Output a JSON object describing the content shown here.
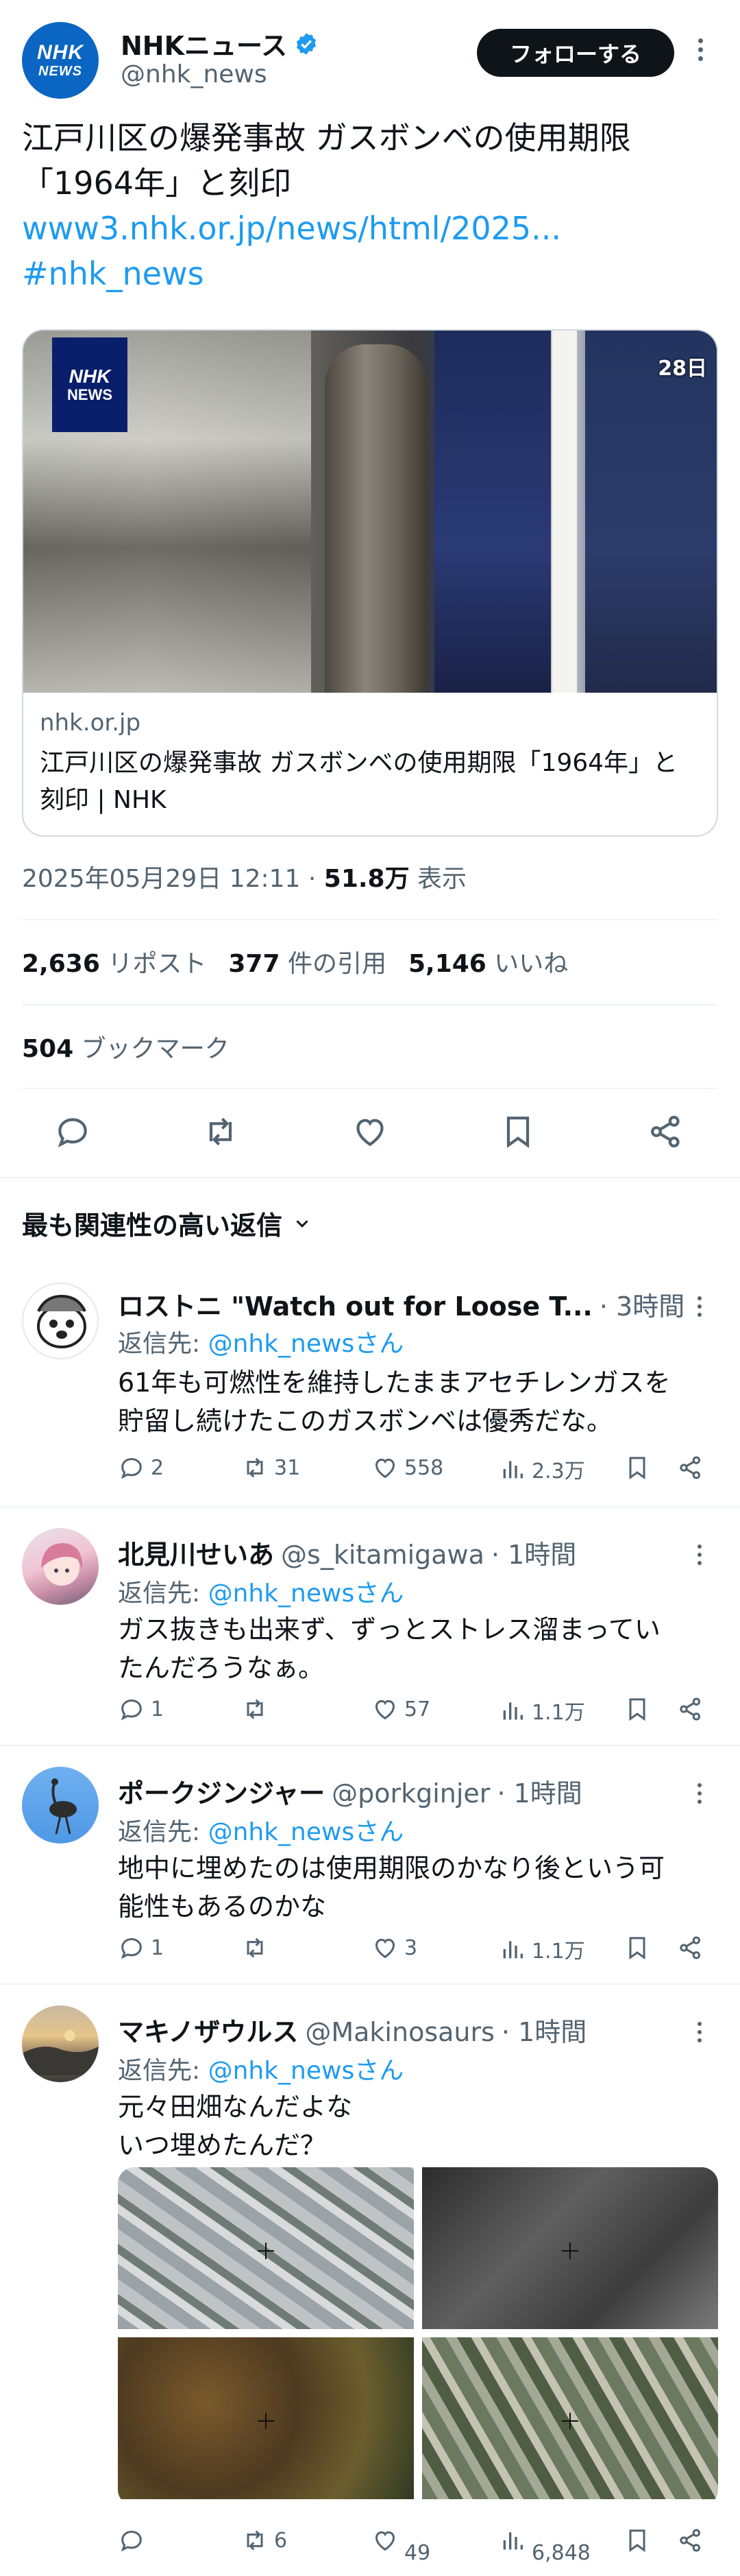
{
  "author": {
    "display_name": "NHKニュース",
    "handle": "@nhk_news",
    "avatar_text": [
      "NHK",
      "NEWS"
    ],
    "follow_label": "フォローする"
  },
  "tweet": {
    "text_lines": [
      "江戸川区の爆発事故 ガスボンベの使用期限",
      "「1964年」と刻印"
    ],
    "link": "www3.nhk.or.jp/news/html/2025...",
    "hashtag": "#nhk_news"
  },
  "card": {
    "badge": [
      "NHK",
      "NEWS"
    ],
    "corner_text": "28日",
    "domain": "nhk.or.jp",
    "title": "江戸川区の爆発事故 ガスボンベの使用期限「1964年」と刻印 | NHK"
  },
  "meta": {
    "timestamp": "2025年05月29日 12:11 · ",
    "views": "51.8万",
    "views_label": " 表示"
  },
  "stats": {
    "reposts": "2,636",
    "reposts_label": "リポスト",
    "quotes": "377",
    "quotes_label": "件の引用",
    "likes": "5,146",
    "likes_label": "いいね",
    "bookmarks": "504",
    "bookmarks_label": "ブックマーク"
  },
  "sort": {
    "label": "最も関連性の高い返信"
  },
  "replies": [
    {
      "name": "ロストニ \"Watch out for Loose T...",
      "handle": "",
      "time": "· 3時間",
      "reply_to_prefix": "返信先: ",
      "reply_to": "@nhk_newsさん",
      "body": [
        "61年も可燃性を維持したままアセチレンガスを",
        "貯留し続けたこのガスボンベは優秀だな。"
      ],
      "replies": "2",
      "reposts": "31",
      "likes": "558",
      "views": "2.3万"
    },
    {
      "name": "北見川せいあ",
      "handle": "@s_kitamigawa",
      "time": "· 1時間",
      "reply_to_prefix": "返信先: ",
      "reply_to": "@nhk_newsさん",
      "body": [
        "ガス抜きも出来ず、ずっとストレス溜まってい",
        "たんだろうなぁ。"
      ],
      "replies": "1",
      "reposts": "",
      "likes": "57",
      "views": "1.1万"
    },
    {
      "name": "ポークジンジャー",
      "handle": "@porkginjer",
      "time": "· 1時間",
      "reply_to_prefix": "返信先: ",
      "reply_to": "@nhk_newsさん",
      "body": [
        "地中に埋めたのは使用期限のかなり後という可",
        "能性もあるのかな"
      ],
      "replies": "1",
      "reposts": "",
      "likes": "3",
      "views": "1.1万"
    },
    {
      "name": "マキノザウルス",
      "handle": "@Makinosaurs",
      "time": "· 1時間",
      "reply_to_prefix": "返信先: ",
      "reply_to": "@nhk_newsさん",
      "body": [
        "元々田畑なんだよな",
        "いつ埋めたんだ？"
      ],
      "replies": "",
      "reposts": "6",
      "likes": "49",
      "views": "6,848"
    }
  ],
  "colors": {
    "accent": "#1d9bf0",
    "text": "#0f1419",
    "muted": "#536471",
    "nhk_blue": "#0a66c2"
  }
}
